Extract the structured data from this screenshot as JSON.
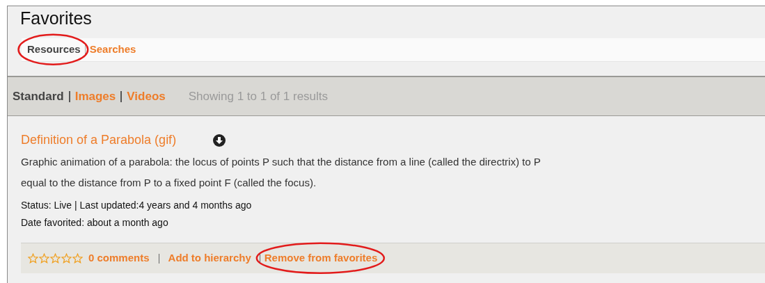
{
  "page": {
    "title": "Favorites"
  },
  "tabs": [
    {
      "label": "Resources",
      "selected": true,
      "highlighted": true
    },
    {
      "label": "Searches",
      "selected": false,
      "highlighted": false
    }
  ],
  "view_filters": [
    {
      "label": "Standard",
      "selected": true
    },
    {
      "label": "Images",
      "selected": false
    },
    {
      "label": "Videos",
      "selected": false
    }
  ],
  "results_summary": "Showing 1 to 1 of 1 results",
  "result": {
    "title": "Definition of a Parabola (gif)",
    "description": "Graphic animation of a parabola: the locus of points P such that the distance from a line (called the directrix) to P\nequal to the distance from P to a fixed point F (called the focus).",
    "status_line": "Status: Live | Last updated:4 years and 4 months ago",
    "date_favorited": "Date favorited: about a month ago",
    "stars": 0,
    "actions": [
      {
        "label": "0 comments",
        "highlighted": false
      },
      {
        "label": "Add to hierarchy",
        "highlighted": false
      },
      {
        "label": "Remove from favorites",
        "highlighted": true
      }
    ]
  }
}
